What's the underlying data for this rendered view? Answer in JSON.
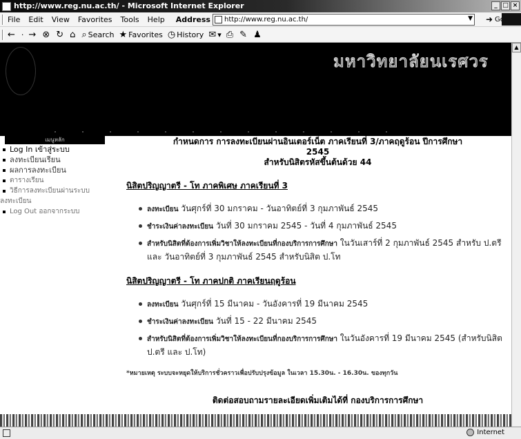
{
  "window": {
    "title": "http://www.reg.nu.ac.th/ - Microsoft Internet Explorer"
  },
  "menu": {
    "items": [
      "File",
      "Edit",
      "View",
      "Favorites",
      "Tools",
      "Help"
    ]
  },
  "address": {
    "label": "Address",
    "url": "http://www.reg.nu.ac.th/",
    "go_label": "Go"
  },
  "toolbar": {
    "search": "Search",
    "favorites": "Favorites",
    "history": "History"
  },
  "banner": {
    "title": "มหาวิทยาลัยนเรศวร"
  },
  "sidebar": {
    "header": "เมนูหลัก",
    "items": [
      {
        "label": "Log In เข้าสู่ระบบ"
      },
      {
        "label": "ลงทะเบียนเรียน"
      },
      {
        "label": "ผลการลงทะเบียน"
      },
      {
        "label": "ตารางเรียน"
      },
      {
        "label": "วิธีการลงทะเบียนผ่านระบบ",
        "continuation": "ลงทะเบียน"
      },
      {
        "label": "Log Out ออกจากระบบ"
      }
    ]
  },
  "main": {
    "heading_line1": "กำหนดการ การลงทะเบียนผ่านอินเตอร์เน็ต ภาคเรียนที่ 3/ภาคฤดูร้อน ปีการศึกษา",
    "heading_line2": "2545",
    "heading_line3": "สำหรับนิสิตรหัสขึ้นต้นด้วย 44",
    "sections": [
      {
        "title": "นิสิตปริญญาตรี - โท ภาคพิเศษ ภาคเรียนที่ 3",
        "items": [
          {
            "label": "ลงทะเบียน",
            "text": "วันศุกร์ที่ 30 มกราคม - วันอาทิตย์ที่ 3 กุมภาพันธ์ 2545"
          },
          {
            "label": "ชำระเงินค่าลงทะเบียน",
            "text": "วันที่ 30 มกราคม 2545 - วันที่ 4 กุมภาพันธ์ 2545"
          },
          {
            "label": "สำหรับนิสิตที่ต้องการเพิ่มวิชาให้ลงทะเบียนที่กองบริการการศึกษา",
            "text": "ในวันเสาร์ที่ 2 กุมภาพันธ์ 2545 สำหรับ ป.ตรี และ วันอาทิตย์ที่ 3 กุมภาพันธ์ 2545 สำหรับนิสิต ป.โท"
          }
        ]
      },
      {
        "title": "นิสิตปริญญาตรี - โท ภาคปกติ ภาคเรียนฤดูร้อน",
        "items": [
          {
            "label": "ลงทะเบียน",
            "text": "วันศุกร์ที่ 15 มีนาคม - วันอังคารที่ 19 มีนาคม 2545"
          },
          {
            "label": "ชำระเงินค่าลงทะเบียน",
            "text": "วันที่ 15 - 22 มีนาคม 2545"
          },
          {
            "label": "สำหรับนิสิตที่ต้องการเพิ่มวิชาให้ลงทะเบียนที่กองบริการการศึกษา",
            "text": "ในวันอังคารที่ 19 มีนาคม 2545 (สำหรับนิสิต ป.ตรี และ ป.โท)"
          }
        ]
      }
    ],
    "note": "*หมายเหตุ ระบบจะหยุดให้บริการชั่วคราวเพื่อปรับปรุงข้อมูล ในเวลา 15.30น. - 16.30น. ของทุกวัน",
    "contact": "ติดต่อสอบถามรายละเอียดเพิ่มเติมได้ที่ กองบริการการศึกษา"
  },
  "status": {
    "text": "",
    "zone": "Internet"
  }
}
